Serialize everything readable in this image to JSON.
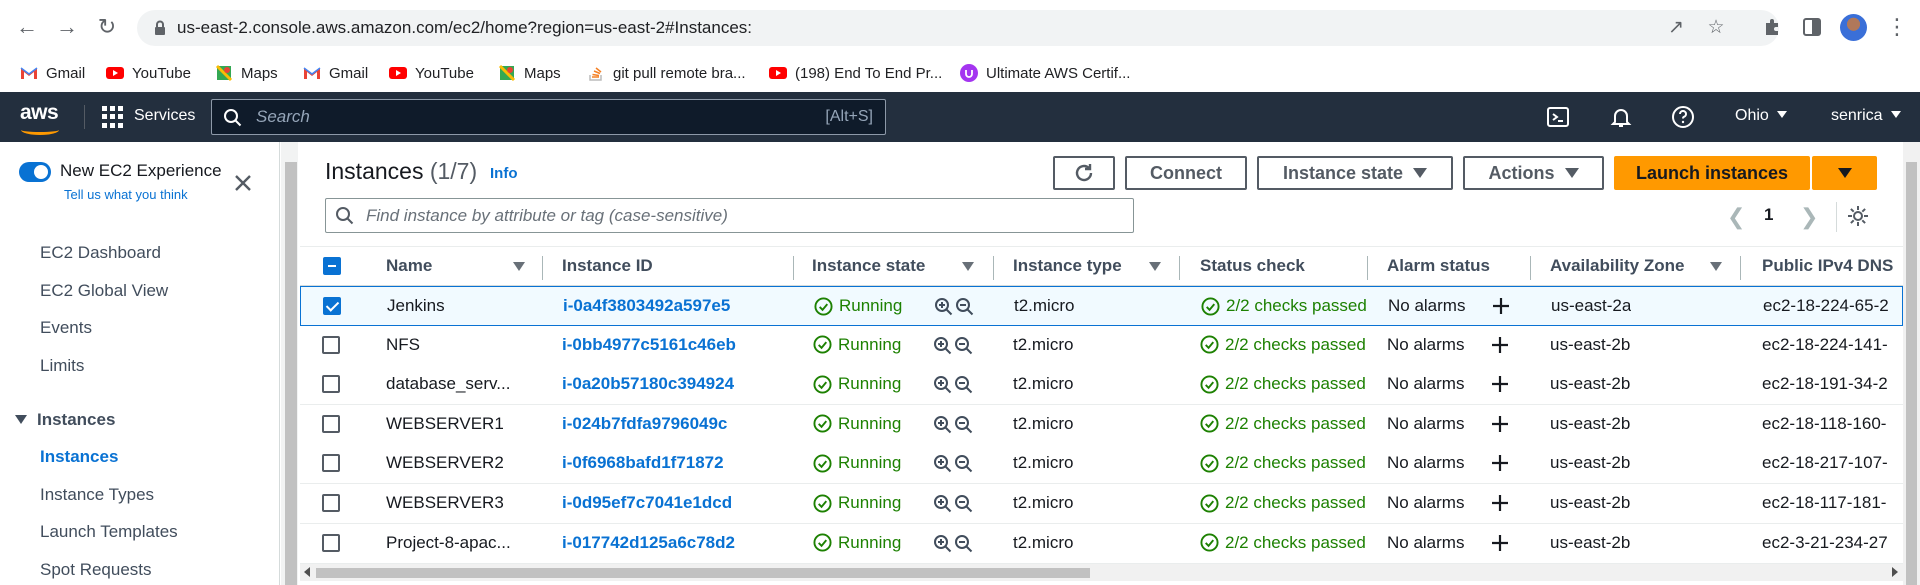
{
  "browser": {
    "url": "us-east-2.console.aws.amazon.com/ec2/home?region=us-east-2#Instances:",
    "bookmarks": [
      {
        "label": "Gmail",
        "icon": "gmail-icon"
      },
      {
        "label": "YouTube",
        "icon": "youtube-icon"
      },
      {
        "label": "Maps",
        "icon": "maps-icon"
      },
      {
        "label": "Gmail",
        "icon": "gmail-icon"
      },
      {
        "label": "YouTube",
        "icon": "youtube-icon"
      },
      {
        "label": "Maps",
        "icon": "maps-icon"
      },
      {
        "label": "git pull remote bra...",
        "icon": "stackoverflow-icon"
      },
      {
        "label": "(198) End To End Pr...",
        "icon": "youtube-icon"
      },
      {
        "label": "Ultimate AWS Certif...",
        "icon": "udemy-icon"
      }
    ]
  },
  "aws_nav": {
    "logo": "aws",
    "services_label": "Services",
    "search_placeholder": "Search",
    "search_shortcut": "[Alt+S]",
    "region": "Ohio",
    "user": "senrica"
  },
  "sidebar": {
    "experience_title": "New EC2 Experience",
    "experience_subtitle": "Tell us what you think",
    "items_top": [
      "EC2 Dashboard",
      "EC2 Global View",
      "Events",
      "Limits"
    ],
    "section_title": "Instances",
    "section_items": [
      "Instances",
      "Instance Types",
      "Launch Templates",
      "Spot Requests"
    ],
    "active_item": "Instances"
  },
  "main": {
    "title": "Instances",
    "count": "(1/7)",
    "info": "Info",
    "buttons": {
      "connect": "Connect",
      "instance_state": "Instance state",
      "actions": "Actions",
      "launch": "Launch instances"
    },
    "filter_placeholder": "Find instance by attribute or tag (case-sensitive)",
    "page": "1"
  },
  "table": {
    "columns": [
      "Name",
      "Instance ID",
      "Instance state",
      "Instance type",
      "Status check",
      "Alarm status",
      "Availability Zone",
      "Public IPv4 DNS"
    ],
    "rows": [
      {
        "name": "Jenkins",
        "id": "i-0a4f3803492a597e5",
        "state": "Running",
        "type": "t2.micro",
        "status": "2/2 checks passed",
        "alarm": "No alarms",
        "az": "us-east-2a",
        "dns": "ec2-18-224-65-2",
        "selected": true
      },
      {
        "name": "NFS",
        "id": "i-0bb4977c5161c46eb",
        "state": "Running",
        "type": "t2.micro",
        "status": "2/2 checks passed",
        "alarm": "No alarms",
        "az": "us-east-2b",
        "dns": "ec2-18-224-141-",
        "selected": false
      },
      {
        "name": "database_serv...",
        "id": "i-0a20b57180c394924",
        "state": "Running",
        "type": "t2.micro",
        "status": "2/2 checks passed",
        "alarm": "No alarms",
        "az": "us-east-2b",
        "dns": "ec2-18-191-34-2",
        "selected": false
      },
      {
        "name": "WEBSERVER1",
        "id": "i-024b7fdfa9796049c",
        "state": "Running",
        "type": "t2.micro",
        "status": "2/2 checks passed",
        "alarm": "No alarms",
        "az": "us-east-2b",
        "dns": "ec2-18-118-160-",
        "selected": false
      },
      {
        "name": "WEBSERVER2",
        "id": "i-0f6968bafd1f71872",
        "state": "Running",
        "type": "t2.micro",
        "status": "2/2 checks passed",
        "alarm": "No alarms",
        "az": "us-east-2b",
        "dns": "ec2-18-217-107-",
        "selected": false
      },
      {
        "name": "WEBSERVER3",
        "id": "i-0d95ef7c7041e1dcd",
        "state": "Running",
        "type": "t2.micro",
        "status": "2/2 checks passed",
        "alarm": "No alarms",
        "az": "us-east-2b",
        "dns": "ec2-18-117-181-",
        "selected": false
      },
      {
        "name": "Project-8-apac...",
        "id": "i-017742d125a6c78d2",
        "state": "Running",
        "type": "t2.micro",
        "status": "2/2 checks passed",
        "alarm": "No alarms",
        "az": "us-east-2b",
        "dns": "ec2-3-21-234-27",
        "selected": false
      }
    ]
  },
  "colors": {
    "aws_nav_bg": "#232f3e",
    "aws_orange": "#ff9900",
    "link_blue": "#0972d3",
    "success_green": "#1d8102"
  }
}
